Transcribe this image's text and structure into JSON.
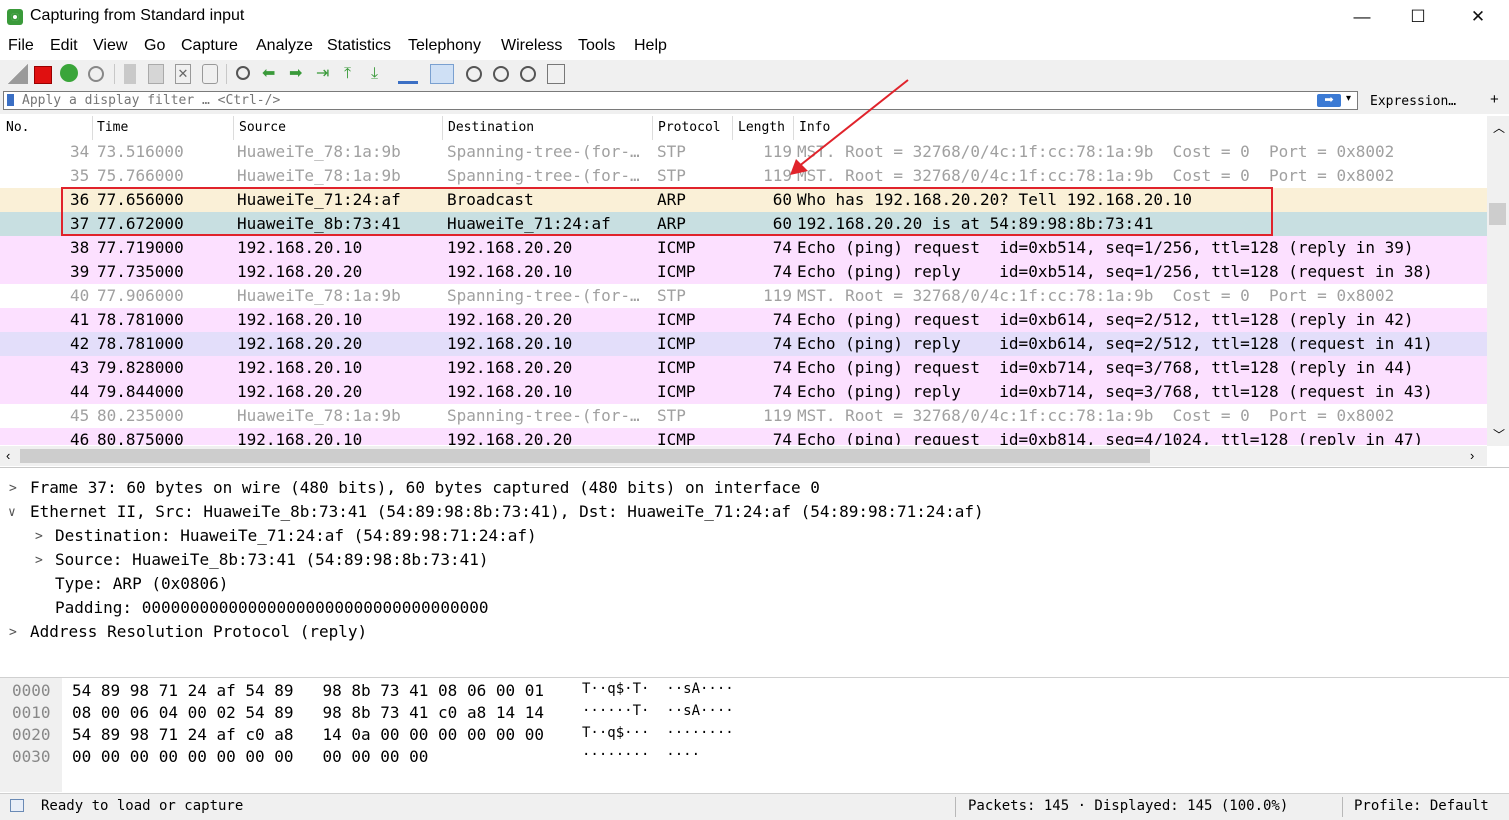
{
  "window": {
    "title": "Capturing from Standard input",
    "minimize": "—",
    "maximize": "☐",
    "close": "✕"
  },
  "menu": [
    "File",
    "Edit",
    "View",
    "Go",
    "Capture",
    "Analyze",
    "Statistics",
    "Telephony",
    "Wireless",
    "Tools",
    "Help"
  ],
  "filter": {
    "placeholder": "Apply a display filter … <Ctrl-/>",
    "expression_label": "Expression…",
    "add_label": "+"
  },
  "columns": [
    "No.",
    "Time",
    "Source",
    "Destination",
    "Protocol",
    "Length",
    "Info"
  ],
  "packets": [
    {
      "no": "34",
      "time": "73.516000",
      "src": "HuaweiTe_78:1a:9b",
      "dst": "Spanning-tree-(for-…",
      "proto": "STP",
      "len": "119",
      "info": "MST. Root = 32768/0/4c:1f:cc:78:1a:9b  Cost = 0  Port = 0x8002"
    },
    {
      "no": "35",
      "time": "75.766000",
      "src": "HuaweiTe_78:1a:9b",
      "dst": "Spanning-tree-(for-…",
      "proto": "STP",
      "len": "119",
      "info": "MST. Root = 32768/0/4c:1f:cc:78:1a:9b  Cost = 0  Port = 0x8002"
    },
    {
      "no": "36",
      "time": "77.656000",
      "src": "HuaweiTe_71:24:af",
      "dst": "Broadcast",
      "proto": "ARP",
      "len": "60",
      "info": "Who has 192.168.20.20? Tell 192.168.20.10"
    },
    {
      "no": "37",
      "time": "77.672000",
      "src": "HuaweiTe_8b:73:41",
      "dst": "HuaweiTe_71:24:af",
      "proto": "ARP",
      "len": "60",
      "info": "192.168.20.20 is at 54:89:98:8b:73:41"
    },
    {
      "no": "38",
      "time": "77.719000",
      "src": "192.168.20.10",
      "dst": "192.168.20.20",
      "proto": "ICMP",
      "len": "74",
      "info": "Echo (ping) request  id=0xb514, seq=1/256, ttl=128 (reply in 39)"
    },
    {
      "no": "39",
      "time": "77.735000",
      "src": "192.168.20.20",
      "dst": "192.168.20.10",
      "proto": "ICMP",
      "len": "74",
      "info": "Echo (ping) reply    id=0xb514, seq=1/256, ttl=128 (request in 38)"
    },
    {
      "no": "40",
      "time": "77.906000",
      "src": "HuaweiTe_78:1a:9b",
      "dst": "Spanning-tree-(for-…",
      "proto": "STP",
      "len": "119",
      "info": "MST. Root = 32768/0/4c:1f:cc:78:1a:9b  Cost = 0  Port = 0x8002"
    },
    {
      "no": "41",
      "time": "78.781000",
      "src": "192.168.20.10",
      "dst": "192.168.20.20",
      "proto": "ICMP",
      "len": "74",
      "info": "Echo (ping) request  id=0xb614, seq=2/512, ttl=128 (reply in 42)"
    },
    {
      "no": "42",
      "time": "78.781000",
      "src": "192.168.20.20",
      "dst": "192.168.20.10",
      "proto": "ICMP",
      "len": "74",
      "info": "Echo (ping) reply    id=0xb614, seq=2/512, ttl=128 (request in 41)"
    },
    {
      "no": "43",
      "time": "79.828000",
      "src": "192.168.20.10",
      "dst": "192.168.20.20",
      "proto": "ICMP",
      "len": "74",
      "info": "Echo (ping) request  id=0xb714, seq=3/768, ttl=128 (reply in 44)"
    },
    {
      "no": "44",
      "time": "79.844000",
      "src": "192.168.20.20",
      "dst": "192.168.20.10",
      "proto": "ICMP",
      "len": "74",
      "info": "Echo (ping) reply    id=0xb714, seq=3/768, ttl=128 (request in 43)"
    },
    {
      "no": "45",
      "time": "80.235000",
      "src": "HuaweiTe_78:1a:9b",
      "dst": "Spanning-tree-(for-…",
      "proto": "STP",
      "len": "119",
      "info": "MST. Root = 32768/0/4c:1f:cc:78:1a:9b  Cost = 0  Port = 0x8002"
    },
    {
      "no": "46",
      "time": "80.875000",
      "src": "192.168.20.10",
      "dst": "192.168.20.20",
      "proto": "ICMP",
      "len": "74",
      "info": "Echo (ping) request  id=0xb814, seq=4/1024, ttl=128 (reply in 47)"
    }
  ],
  "details": [
    "Frame 37: 60 bytes on wire (480 bits), 60 bytes captured (480 bits) on interface 0",
    "Ethernet II, Src: HuaweiTe_8b:73:41 (54:89:98:8b:73:41), Dst: HuaweiTe_71:24:af (54:89:98:71:24:af)",
    "Destination: HuaweiTe_71:24:af (54:89:98:71:24:af)",
    "Source: HuaweiTe_8b:73:41 (54:89:98:8b:73:41)",
    "Type: ARP (0x0806)",
    "Padding: 000000000000000000000000000000000000",
    "Address Resolution Protocol (reply)"
  ],
  "bytes": [
    {
      "offset": "0000",
      "hex": "54 89 98 71 24 af 54 89   98 8b 73 41 08 06 00 01",
      "ascii": "T··q$·T·  ··sA····"
    },
    {
      "offset": "0010",
      "hex": "08 00 06 04 00 02 54 89   98 8b 73 41 c0 a8 14 14",
      "ascii": "······T·  ··sA····"
    },
    {
      "offset": "0020",
      "hex": "54 89 98 71 24 af c0 a8   14 0a 00 00 00 00 00 00",
      "ascii": "T··q$···  ········"
    },
    {
      "offset": "0030",
      "hex": "00 00 00 00 00 00 00 00   00 00 00 00",
      "ascii": "········  ····"
    }
  ],
  "status": {
    "ready": "Ready to load or capture",
    "packets": "Packets: 145 · Displayed: 145 (100.0%)",
    "profile": "Profile: Default"
  },
  "colors": {
    "arp_request": "#faf0d7",
    "arp_reply": "#c8dfe1",
    "icmp": "#fce0ff",
    "annotation": "#e0232b"
  }
}
